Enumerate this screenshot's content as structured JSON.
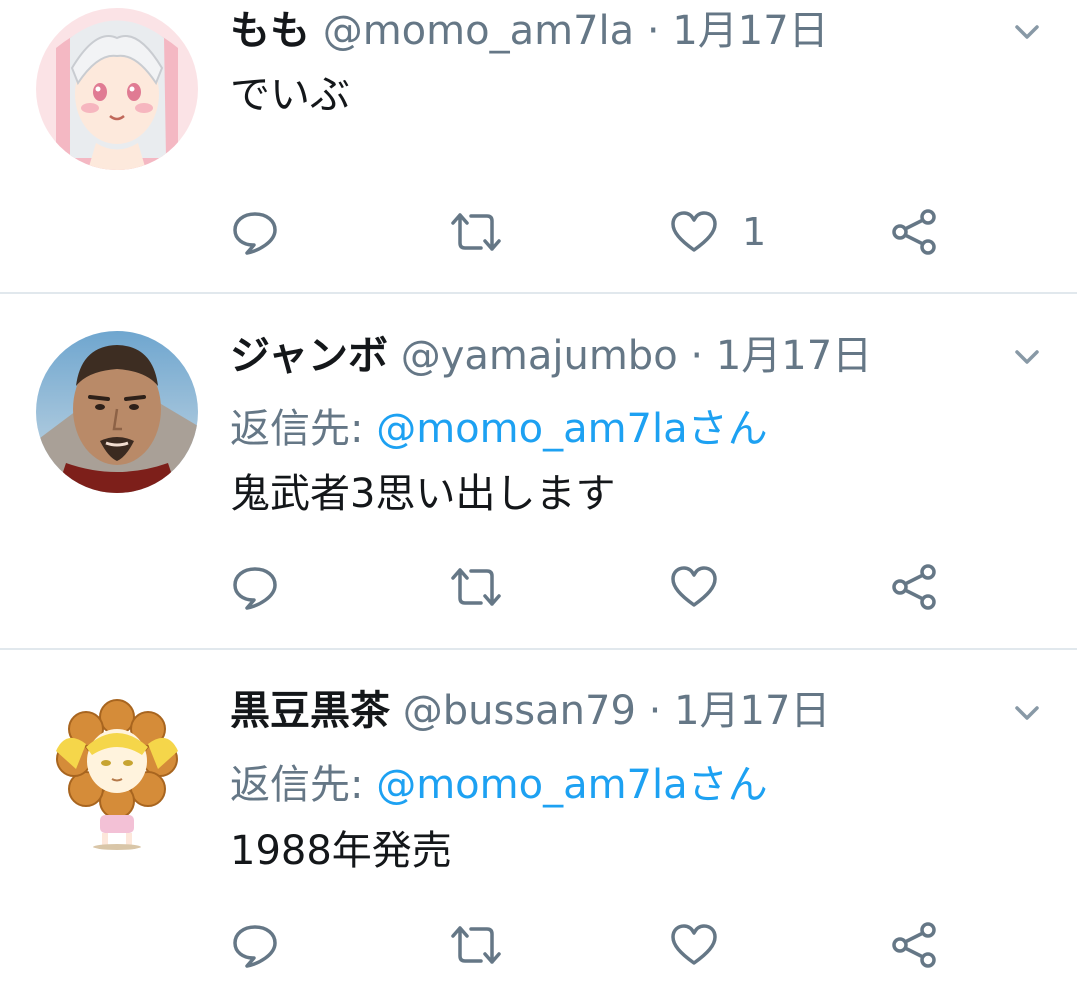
{
  "tweets": [
    {
      "name": "もも",
      "handle": "@momo_am7la",
      "separator": "·",
      "date": "1月17日",
      "reply_prefix": "",
      "reply_to": "",
      "text": "でいぶ",
      "like_count": "1",
      "avatar": "anime-girl-avatar"
    },
    {
      "name": "ジャンボ",
      "handle": "@yamajumbo",
      "separator": "·",
      "date": "1月17日",
      "reply_prefix": "返信先: ",
      "reply_to": "@momo_am7laさん",
      "text": "鬼武者3思い出します",
      "like_count": "",
      "avatar": "samurai-man-avatar"
    },
    {
      "name": "黒豆黒茶",
      "handle": "@bussan79",
      "separator": "·",
      "date": "1月17日",
      "reply_prefix": "返信先: ",
      "reply_to": "@momo_am7laさん",
      "text": "1988年発売",
      "like_count": "",
      "avatar": "donut-character-avatar"
    }
  ],
  "colors": {
    "text": "#14171a",
    "muted": "#657786",
    "link": "#1da1f2",
    "divider": "#e1e8ed"
  },
  "icons": [
    "reply-icon",
    "retweet-icon",
    "like-icon",
    "share-icon",
    "chevron-down-icon"
  ]
}
